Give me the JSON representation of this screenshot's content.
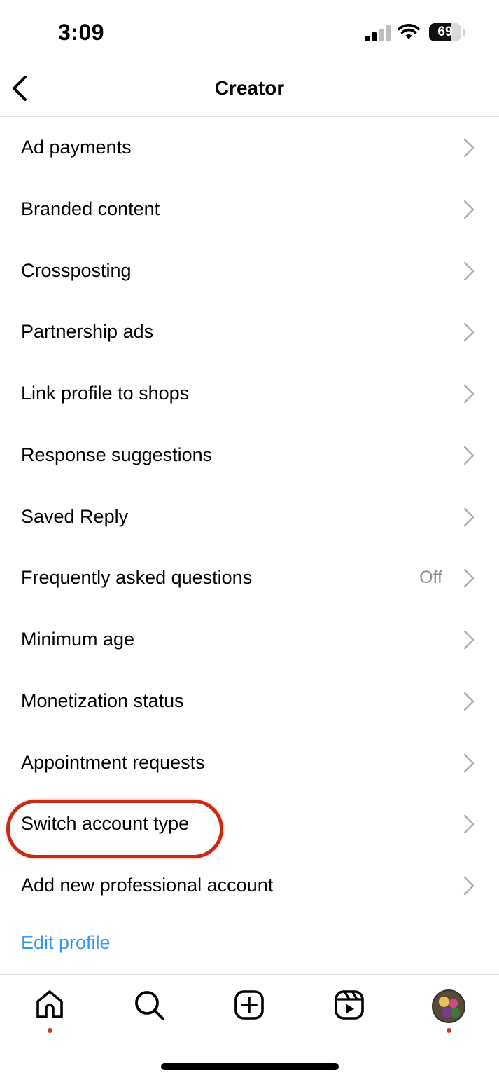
{
  "status_bar": {
    "time": "3:09",
    "battery_level": "69",
    "battery_fraction": 0.69
  },
  "header": {
    "title": "Creator",
    "back_icon": "chevron-left-icon"
  },
  "menu": {
    "items": [
      {
        "label": "Ad payments",
        "value": ""
      },
      {
        "label": "Branded content",
        "value": ""
      },
      {
        "label": "Crossposting",
        "value": ""
      },
      {
        "label": "Partnership ads",
        "value": ""
      },
      {
        "label": "Link profile to shops",
        "value": ""
      },
      {
        "label": "Response suggestions",
        "value": ""
      },
      {
        "label": "Saved Reply",
        "value": ""
      },
      {
        "label": "Frequently asked questions",
        "value": "Off"
      },
      {
        "label": "Minimum age",
        "value": ""
      },
      {
        "label": "Monetization status",
        "value": ""
      },
      {
        "label": "Appointment requests",
        "value": ""
      },
      {
        "label": "Switch account type",
        "value": "",
        "highlighted": true
      },
      {
        "label": "Add new professional account",
        "value": ""
      }
    ],
    "edit_profile_label": "Edit profile"
  },
  "tabbar": {
    "tabs": [
      {
        "icon": "home-icon"
      },
      {
        "icon": "search-icon"
      },
      {
        "icon": "create-plus-icon"
      },
      {
        "icon": "reels-icon"
      },
      {
        "icon": "profile-avatar"
      }
    ]
  },
  "colors": {
    "link": "#3797f0",
    "highlight_ring": "#c8290f",
    "secondary_text": "#8e8e8e",
    "chevron": "#b0b0b0"
  }
}
